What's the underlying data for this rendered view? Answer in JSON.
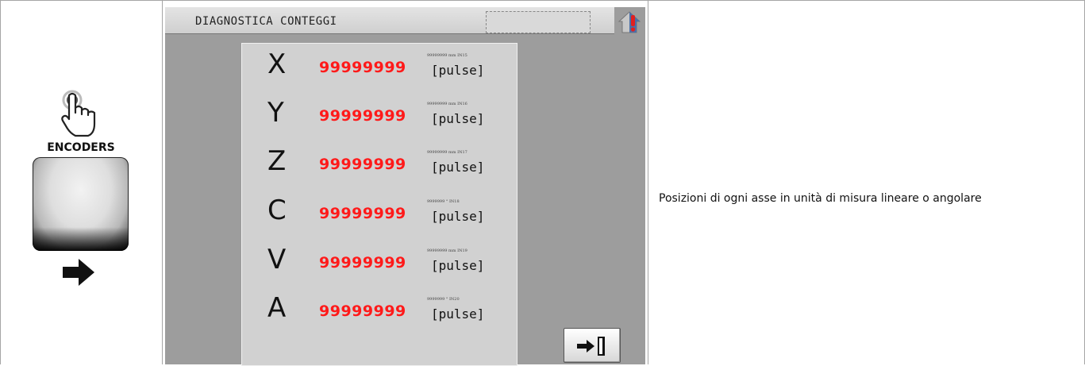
{
  "left_cell": {
    "label": "ENCODERS",
    "hand_icon": "pointing-hand-icon",
    "button_icon": "blank-key-button",
    "arrow_icon": "arrow-right-icon"
  },
  "hmi": {
    "title": "DIAGNOSTICA CONTEGGI",
    "home_icon": "home-alert-icon",
    "exit_icon": "exit-door-icon",
    "rows": [
      {
        "axis": "X",
        "value": "99999999",
        "small": "99999999 mm  IN15",
        "unit": "[pulse]"
      },
      {
        "axis": "Y",
        "value": "99999999",
        "small": "99999999 mm  IN16",
        "unit": "[pulse]"
      },
      {
        "axis": "Z",
        "value": "99999999",
        "small": "99999999 mm  IN17",
        "unit": "[pulse]"
      },
      {
        "axis": "C",
        "value": "99999999",
        "small": "9999999 °  IN18",
        "unit": "[pulse]"
      },
      {
        "axis": "V",
        "value": "99999999",
        "small": "99999999 mm  IN19",
        "unit": "[pulse]"
      },
      {
        "axis": "A",
        "value": "99999999",
        "small": "9999999 °  IN20",
        "unit": "[pulse]"
      }
    ],
    "colors": {
      "value": "#ff1a1a",
      "panel": "#9d9d9d",
      "inner": "#d1d1d1"
    }
  },
  "right_cell": {
    "description": "Posizioni di ogni asse in unità di misura lineare o angolare"
  }
}
